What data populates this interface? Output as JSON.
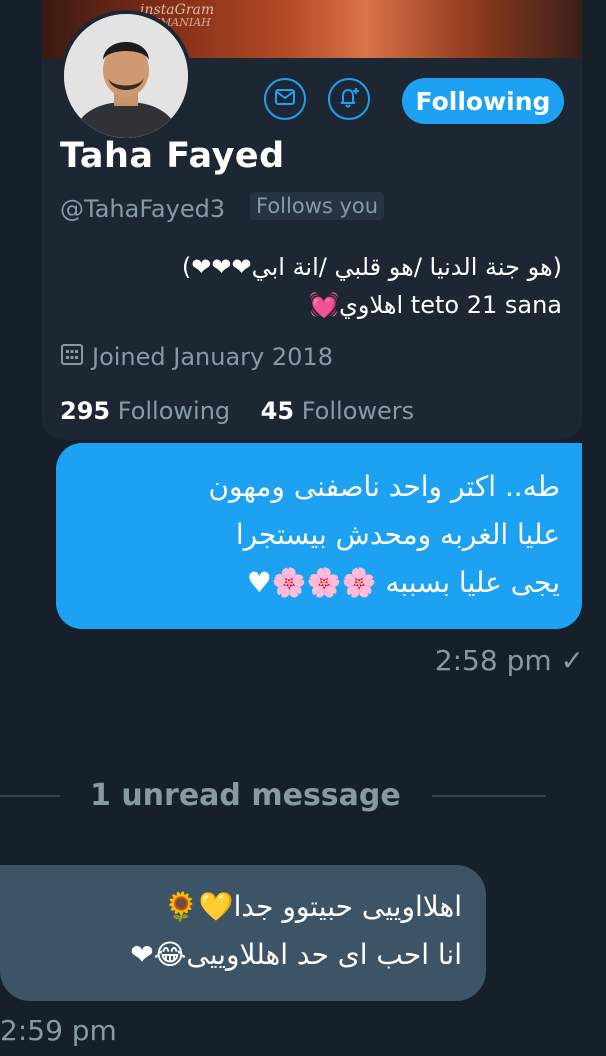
{
  "profile": {
    "banner_text_1": "instaGram",
    "banner_text_2": "EMANIAH",
    "name": "Taha Fayed",
    "handle": "@TahaFayed3",
    "follows_you": "Follows you",
    "follow_button": "Following",
    "bio_line1": "(هو جنة الدنيا /هو قلبي /انة ابي❤❤❤)",
    "bio_line2": "teto 21 sana اهلاوي💓",
    "joined": "Joined January 2018",
    "following_count": "295",
    "following_label": "Following",
    "followers_count": "45",
    "followers_label": "Followers"
  },
  "messages": {
    "outgoing": {
      "line1": "طه.. اكتر واحد ناصفنى ومهون",
      "line2": "عليا الغربه ومحدش بيستجرا",
      "line3": "يجى عليا بسببه 🌸🌸🌸♥",
      "time": "2:58 pm ✓"
    },
    "divider": "1 unread message",
    "incoming": {
      "line1": "اهلااوييى حبيتوو جدا💛🌻",
      "line2": "انا احب اى حد اهللاوييى😂❤",
      "time": "2:59 pm"
    }
  },
  "colors": {
    "background": "#15202b",
    "card": "#1c2733",
    "accent": "#1da1f2",
    "muted": "#8899a6",
    "incoming_bubble": "#3d5466"
  }
}
